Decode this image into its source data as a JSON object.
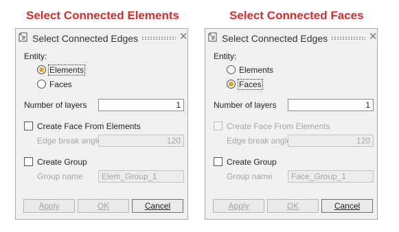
{
  "captions": {
    "left": "Select Connected Elements",
    "right": "Select Connected Faces"
  },
  "dialogs": [
    {
      "title": "Select Connected Edges",
      "entity_label": "Entity:",
      "entity_options": [
        {
          "label": "Elements",
          "selected": true
        },
        {
          "label": "Faces",
          "selected": false
        }
      ],
      "layers_label": "Number of layers",
      "layers_value": "1",
      "create_face_label": "Create Face From Elements",
      "create_face_checked": false,
      "create_face_enabled": true,
      "edge_angle_label": "Edge break angle",
      "edge_angle_value": "120",
      "create_group_label": "Create Group",
      "create_group_checked": false,
      "group_name_label": "Group name",
      "group_name_value": "Elem_Group_1",
      "buttons": {
        "apply": "Apply",
        "ok": "OK",
        "cancel": "Cancel"
      }
    },
    {
      "title": "Select Connected Edges",
      "entity_label": "Entity:",
      "entity_options": [
        {
          "label": "Elements",
          "selected": false
        },
        {
          "label": "Faces",
          "selected": true
        }
      ],
      "layers_label": "Number of layers",
      "layers_value": "1",
      "create_face_label": "Create Face From Elements",
      "create_face_checked": false,
      "create_face_enabled": false,
      "edge_angle_label": "Edge break angle",
      "edge_angle_value": "120",
      "create_group_label": "Create Group",
      "create_group_checked": false,
      "group_name_label": "Group name",
      "group_name_value": "Face_Group_1",
      "buttons": {
        "apply": "Apply",
        "ok": "OK",
        "cancel": "Cancel"
      }
    }
  ],
  "colors": {
    "caption": "#d32f2f",
    "radio_selected": "#e3a119",
    "panel_bg": "#f1f1f1"
  },
  "icons": {
    "dialog": "document-icon",
    "close": "close-icon",
    "grip": "drag-grip-icon"
  }
}
